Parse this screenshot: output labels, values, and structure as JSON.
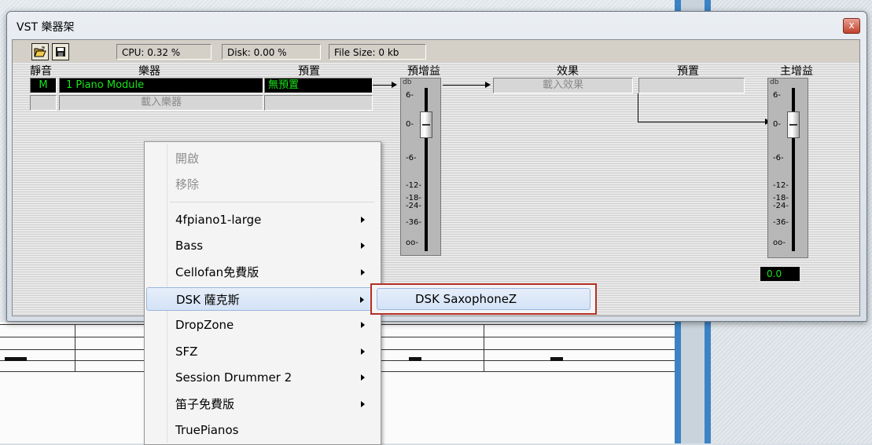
{
  "window": {
    "title": "VST 樂器架",
    "close_label": "x"
  },
  "toolbar": {
    "cpu": "CPU: 0.32 %",
    "disk": "Disk: 0.00 %",
    "file_size": "File Size: 0 kb",
    "open_icon": "folder-open-icon",
    "save_icon": "floppy-disk-icon"
  },
  "columns": {
    "mute": "靜音",
    "instrument": "樂器",
    "preset": "預置",
    "pre_gain": "預增益",
    "effect": "效果",
    "effect_preset": "預置",
    "master_gain": "主增益"
  },
  "rows": [
    {
      "mute": "M",
      "instrument": "1  Piano Module",
      "preset": "無預置",
      "effect": "載入效果"
    },
    {
      "mute": "",
      "instrument": "載入樂器",
      "preset": ""
    }
  ],
  "fader": {
    "unit": "db",
    "ticks": [
      "6-",
      "0-",
      "-6-",
      "-12-",
      "-18-",
      "-24-",
      "-36-",
      "oo-"
    ],
    "master_value": "0.0"
  },
  "context_menu": {
    "items": [
      {
        "label": "開啟",
        "disabled": true,
        "submenu": false
      },
      {
        "label": "移除",
        "disabled": true,
        "submenu": false
      },
      {
        "label": "4fpiano1-large",
        "disabled": false,
        "submenu": true
      },
      {
        "label": "Bass",
        "disabled": false,
        "submenu": true
      },
      {
        "label": "Cellofan免費版",
        "disabled": false,
        "submenu": true
      },
      {
        "label": "DSK 薩克斯",
        "disabled": false,
        "submenu": true,
        "highlighted": true
      },
      {
        "label": "DropZone",
        "disabled": false,
        "submenu": true
      },
      {
        "label": "SFZ",
        "disabled": false,
        "submenu": true
      },
      {
        "label": "Session Drummer 2",
        "disabled": false,
        "submenu": true
      },
      {
        "label": "笛子免費版",
        "disabled": false,
        "submenu": true
      },
      {
        "label": "TruePianos",
        "disabled": false,
        "submenu": false
      }
    ]
  },
  "submenu": {
    "item": "DSK SaxophoneZ",
    "outline_color": "#b33024"
  },
  "colors": {
    "led_green": "#19e519",
    "accent_blue": "#3c82c4"
  }
}
